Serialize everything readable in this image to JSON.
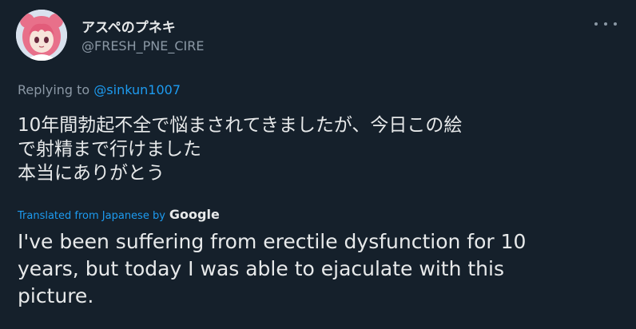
{
  "colors": {
    "background": "#15202b",
    "text_primary": "#e7e9ea",
    "text_secondary": "#8b98a5",
    "link": "#1d9bf0"
  },
  "user": {
    "display_name": "アスペのプネキ",
    "handle": "@FRESH_PNE_CIRE",
    "avatar_icon": "anime-girl-avatar"
  },
  "reply": {
    "prefix": "Replying to ",
    "mention": "@sinkun1007"
  },
  "tweet": {
    "original_lines": [
      "10年間勃起不全で悩まされてきましたが、今日この絵",
      "で射精まで行けました",
      "本当にありがとう"
    ],
    "translation_label": "Translated from Japanese by",
    "translation_provider": "Google",
    "translated_lines": [
      "I've been suffering from erectile dysfunction for 10",
      "years, but today I was able to ejaculate with this",
      "picture."
    ]
  },
  "menu": {
    "icon": "more-options-icon"
  }
}
